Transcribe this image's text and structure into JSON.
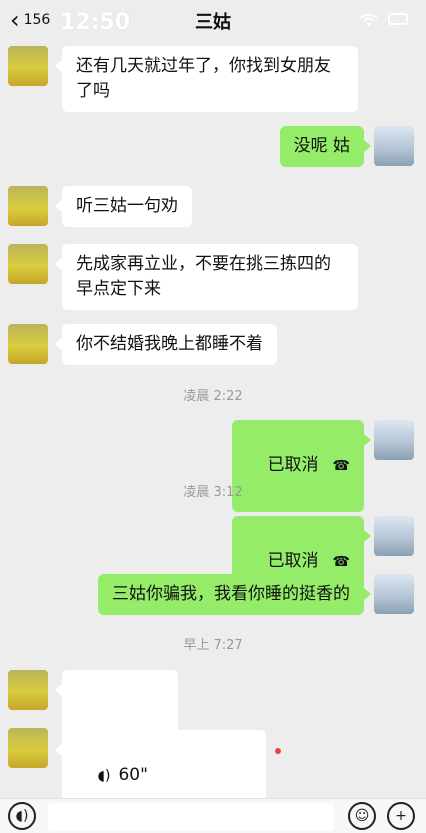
{
  "status_bar": {
    "time": "12:50"
  },
  "header": {
    "back_count": "156",
    "title": "三姑"
  },
  "messages": [
    {
      "dir": "in",
      "text": "还有几天就过年了，你找到女朋友\n了吗"
    },
    {
      "dir": "out",
      "text": "没呢 姑"
    },
    {
      "dir": "in",
      "text": "听三姑一句劝"
    },
    {
      "dir": "in",
      "text": "先成家再立业，不要在挑三拣四的\n早点定下来"
    },
    {
      "dir": "in",
      "text": "你不结婚我晚上都睡不着"
    },
    {
      "type": "timestamp",
      "text": "凌晨 2:22"
    },
    {
      "dir": "out",
      "text": "已取消",
      "call": true
    },
    {
      "type": "timestamp",
      "text": "凌晨 3:12"
    },
    {
      "dir": "out",
      "text": "已取消",
      "call": true
    },
    {
      "dir": "out",
      "text": "三姑你骗我，我看你睡的挺香的"
    },
    {
      "type": "timestamp",
      "text": "早上 7:27"
    },
    {
      "dir": "in",
      "text": "😊😊😊",
      "emoji": true
    },
    {
      "dir": "in",
      "text": "60\"",
      "voice": true
    }
  ],
  "colors": {
    "bg": "#ededed",
    "out_bubble": "#95ec69",
    "in_bubble": "#ffffff",
    "unread_dot": "#e64340"
  },
  "icons": {
    "back": "chevron-left-icon",
    "voice": "voice-wave-icon",
    "call_cancelled": "phone-hangup-icon",
    "emoji": "emoji-icon",
    "plus": "plus-icon"
  }
}
